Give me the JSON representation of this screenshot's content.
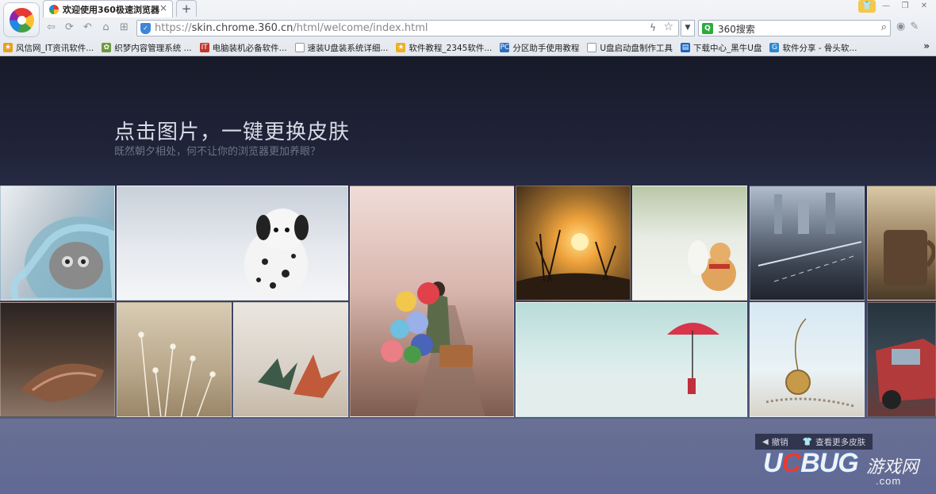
{
  "browser": {
    "tab_title": "欢迎使用360极速浏览器",
    "tab_close": "×",
    "newtab": "+",
    "url_scheme": "https://",
    "url_host": "skin.chrome.360.cn",
    "url_path": "/html/welcome/index.html",
    "search_placeholder": "360搜索",
    "bookmarks": [
      {
        "label": "风信网_IT资讯软件...",
        "icon_color": "#e8a020"
      },
      {
        "label": "织梦内容管理系统 ...",
        "icon_color": "#6a9a3a"
      },
      {
        "label": "电脑装机必备软件...",
        "icon_color": "#c0392b"
      },
      {
        "label": "速装U盘装系统详细...",
        "icon_color": "#ffffff"
      },
      {
        "label": "软件教程_2345软件...",
        "icon_color": "#f0b020"
      },
      {
        "label": "分区助手使用教程",
        "icon_color": "#2c6fbf"
      },
      {
        "label": "U盘启动盘制作工具",
        "icon_color": "#ffffff"
      },
      {
        "label": "下载中心_黑牛U盘",
        "icon_color": "#1a66c2"
      },
      {
        "label": "软件分享 - 骨头软...",
        "icon_color": "#2a8ad0"
      }
    ],
    "bookmarks_more": "»"
  },
  "page": {
    "title": "点击图片，一键更换皮肤",
    "subtitle": "既然朝夕相处，何不让你的浏览器更加养眼？",
    "undo_label": "撤销",
    "more_skins_label": "查看更多皮肤"
  },
  "skins": [
    {
      "name": "skin-kitten",
      "bg": "linear-gradient(120deg,#eceff1 0%,#b6c2cc 45%,#8fb3c4 70%,#6e9db3 100%)"
    },
    {
      "name": "skin-dalmatian",
      "bg": "linear-gradient(180deg,#c9d0da 0%,#e6e9ee 55%,#f4f5f7 100%)"
    },
    {
      "name": "skin-balloon-girl",
      "bg": "linear-gradient(180deg,#f1dcd8 0%,#d8b6ae 45%,#9f7a6c 80%,#7d5d50 100%)"
    },
    {
      "name": "skin-sunset-grass",
      "bg": "radial-gradient(circle at 55% 48%,#ffe08a 0%,#f0a33c 25%,#9a6a2c 55%,#3d2a1a 100%)"
    },
    {
      "name": "skin-toy-deer",
      "bg": "linear-gradient(180deg,#b9c8a8 0%,#e8ece4 45%,#f5f6f2 100%)"
    },
    {
      "name": "skin-rainy-street",
      "bg": "linear-gradient(180deg,#b0bccb 0%,#6d7888 40%,#3b4350 70%,#1e242c 100%)"
    },
    {
      "name": "skin-coffee-cup",
      "bg": "linear-gradient(180deg,#d9c8a6 0%,#8a7050 60%,#4a3a28 100%)"
    },
    {
      "name": "skin-seashell",
      "bg": "linear-gradient(180deg,#2b2421 0%,#5a4538 55%,#8c7566 100%)"
    },
    {
      "name": "skin-dry-flowers",
      "bg": "linear-gradient(180deg,#d8ccb4 0%,#b9a78a 60%,#9a8668 100%)"
    },
    {
      "name": "skin-paper-cranes",
      "bg": "linear-gradient(180deg,#eae6df 0%,#d8d0c6 60%,#c6b8a8 100%)"
    },
    {
      "name": "skin-umbrella-beach",
      "bg": "linear-gradient(180deg,#b9dcd8 0%,#d9eceb 50%,#f1f6f5 100%)"
    },
    {
      "name": "skin-globe-necklace",
      "bg": "linear-gradient(180deg,#d7e8f3 0%,#eaf2f5 60%,#d8d3c9 100%)"
    },
    {
      "name": "skin-red-car",
      "bg": "linear-gradient(180deg,#26333d 0%,#3a4a55 50%,#6a3a38 100%)"
    }
  ],
  "watermark": {
    "brand_u": "U",
    "brand_c": "C",
    "brand_rest": "BUG",
    "brand_cn": "游戏网",
    "brand_dot": ".com"
  }
}
